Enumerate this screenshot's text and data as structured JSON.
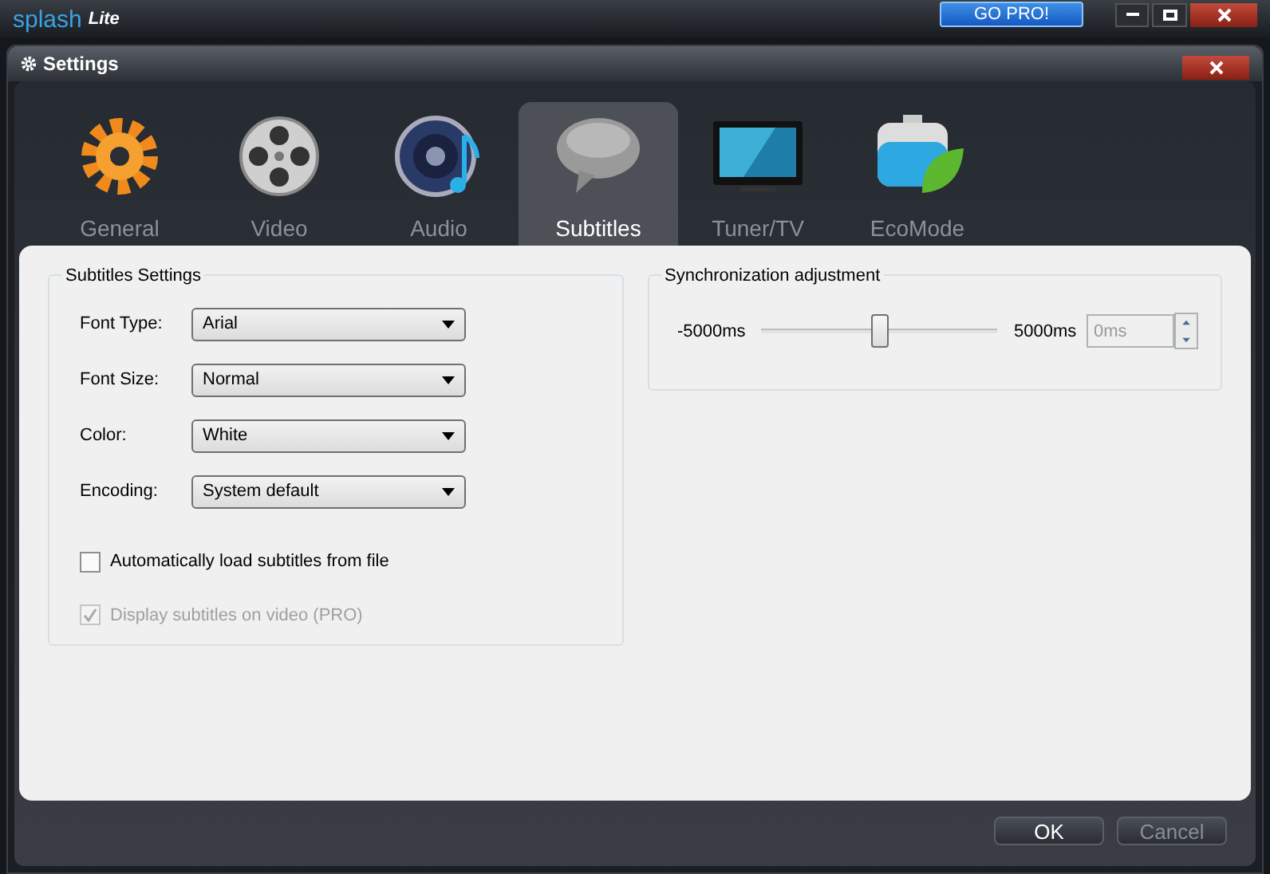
{
  "app": {
    "logo": "splash",
    "edition": "Lite",
    "go_pro": "GO PRO!"
  },
  "dialog": {
    "title": "Settings"
  },
  "tabs": [
    {
      "label": "General",
      "kind": "gear",
      "selected": false
    },
    {
      "label": "Video",
      "kind": "reel",
      "selected": false
    },
    {
      "label": "Audio",
      "kind": "speaker",
      "selected": false
    },
    {
      "label": "Subtitles",
      "kind": "bubble",
      "selected": true
    },
    {
      "label": "Tuner/TV",
      "kind": "tv",
      "selected": false
    },
    {
      "label": "EcoMode",
      "kind": "battery",
      "selected": false
    }
  ],
  "subtitles_settings": {
    "title": "Subtitles Settings",
    "fields": [
      {
        "label": "Font Type:",
        "value": "Arial"
      },
      {
        "label": "Font Size:",
        "value": "Normal"
      },
      {
        "label": "Color:",
        "value": "White"
      },
      {
        "label": "Encoding:",
        "value": "System default"
      }
    ],
    "checkboxes": [
      {
        "label": "Automatically load subtitles from file",
        "checked": false,
        "disabled": false
      },
      {
        "label": "Display subtitles on video (PRO)",
        "checked": true,
        "disabled": true
      }
    ]
  },
  "synchronization": {
    "title": "Synchronization adjustment",
    "min": "-5000ms",
    "max": "5000ms",
    "level": 0.5,
    "value": "0ms",
    "disabled": true
  },
  "buttons": [
    {
      "label": "OK",
      "disabled": false
    },
    {
      "label": "Cancel",
      "disabled": true
    }
  ]
}
